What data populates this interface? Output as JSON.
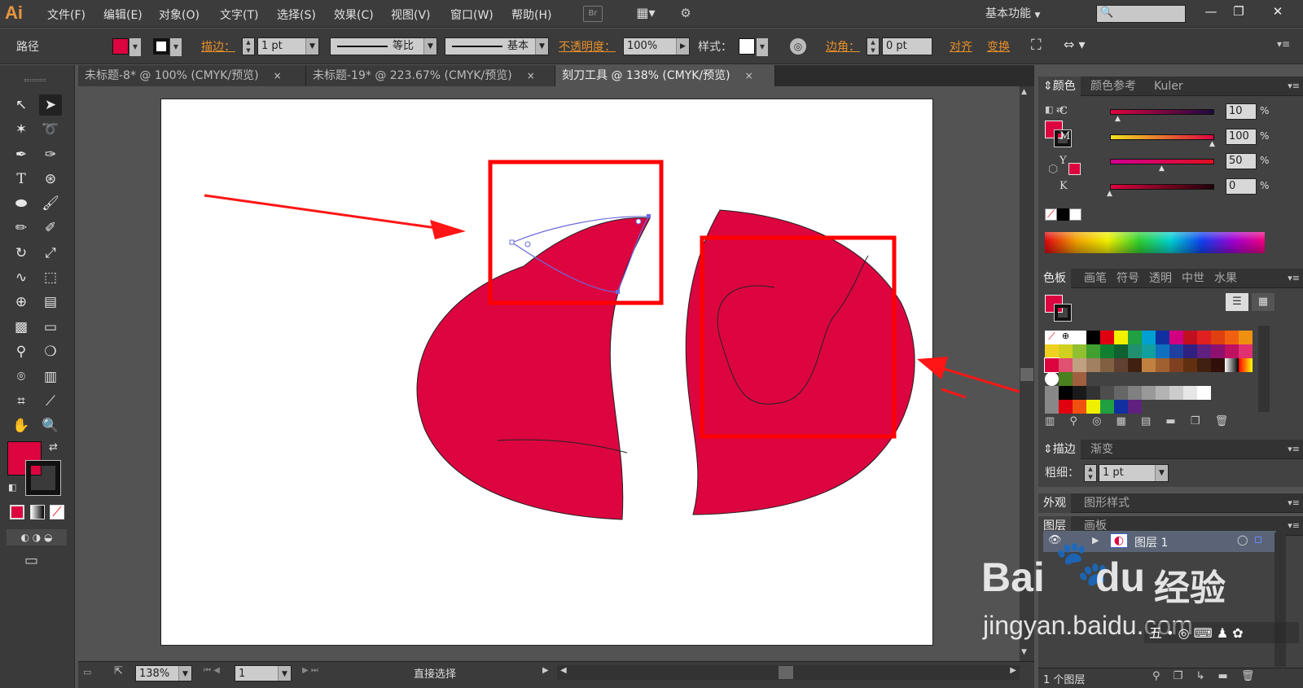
{
  "app": {
    "logo": "Ai",
    "workspace": "基本功能",
    "workspace_arrow": "▼",
    "br": "Br"
  },
  "menu": [
    "文件(F)",
    "编辑(E)",
    "对象(O)",
    "文字(T)",
    "选择(S)",
    "效果(C)",
    "视图(V)",
    "窗口(W)",
    "帮助(H)"
  ],
  "window_buttons": [
    "—",
    "❐",
    "✕"
  ],
  "control": {
    "object_type": "路径",
    "fill_color": "#dc0540",
    "stroke_label": "描边：",
    "stroke_weight": "1 pt",
    "profile_label": "等比",
    "brush_label": "基本",
    "opacity_label": "不透明度：",
    "opacity_value": "100%",
    "style_label": "样式：",
    "corner_label": "边角：",
    "corner_value": "0 pt",
    "align_label": "对齐",
    "transform_label": "变换"
  },
  "tabs": [
    {
      "label": "未标题-8* @ 100% (CMYK/预览)",
      "close": "×"
    },
    {
      "label": "未标题-19* @ 223.67% (CMYK/预览)",
      "close": "×"
    },
    {
      "label": "刻刀工具 @ 138% (CMYK/预览)",
      "close": "×"
    }
  ],
  "colors": {
    "shape_fill": "#dc0540",
    "highlight_box": "#ff0000",
    "arrow": "#ff1515",
    "anchor": "#6a6adc"
  },
  "color_panel": {
    "tabs": [
      "颜色",
      "颜色参考",
      "Kuler"
    ],
    "channels": [
      {
        "label": "C",
        "value": "10",
        "pct": "%"
      },
      {
        "label": "M",
        "value": "100",
        "pct": "%"
      },
      {
        "label": "Y",
        "value": "50",
        "pct": "%"
      },
      {
        "label": "K",
        "value": "0",
        "pct": "%"
      }
    ]
  },
  "swatches_panel": {
    "tabs": [
      "色板",
      "画笔",
      "符号",
      "透明",
      "中世",
      "水果"
    ]
  },
  "stroke_panel": {
    "tabs": [
      "描边",
      "渐变"
    ],
    "weight_label": "粗细：",
    "weight_value": "1 pt"
  },
  "appearance_panel": {
    "tabs": [
      "外观",
      "图形样式"
    ]
  },
  "layers_panel": {
    "tabs": [
      "图层",
      "画板"
    ],
    "layer_name": "图层 1",
    "count": "1 个图层"
  },
  "status": {
    "zoom": "138%",
    "page": "1",
    "tool": "直接选择"
  },
  "watermark": {
    "brand": "Bai",
    "brand2": "du",
    "cn": "经验",
    "url": "jingyan.baidu.com"
  }
}
